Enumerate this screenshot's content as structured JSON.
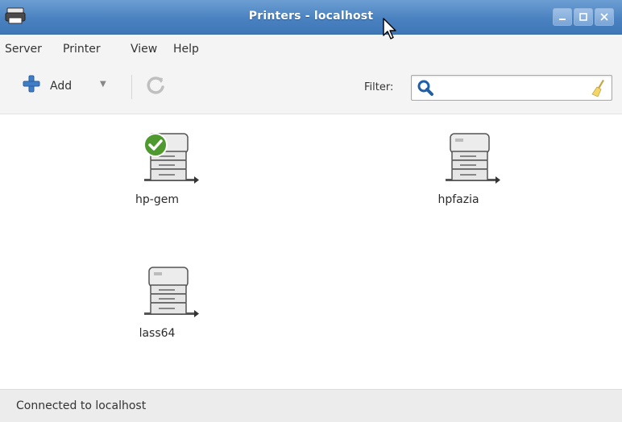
{
  "window": {
    "title": "Printers - localhost",
    "accent_color": "#4a82c1",
    "icons": [
      "printer-app-icon",
      "minimize-icon",
      "maximize-icon",
      "close-icon"
    ]
  },
  "menu": {
    "items": [
      {
        "label": "Server"
      },
      {
        "label": "Printer"
      },
      {
        "label": "View"
      },
      {
        "label": "Help"
      }
    ]
  },
  "toolbar": {
    "add_label": "Add",
    "add_icon": "plus-icon",
    "refresh_icon": "refresh-icon",
    "filter_label": "Filter:",
    "filter_value": "",
    "filter_icons": [
      "search-icon",
      "clear-broom-icon"
    ]
  },
  "printers": [
    {
      "name": "hp-gem",
      "is_default": true
    },
    {
      "name": "hpfazia",
      "is_default": false
    },
    {
      "name": "lass64",
      "is_default": false
    }
  ],
  "status": {
    "text": "Connected to localhost"
  }
}
